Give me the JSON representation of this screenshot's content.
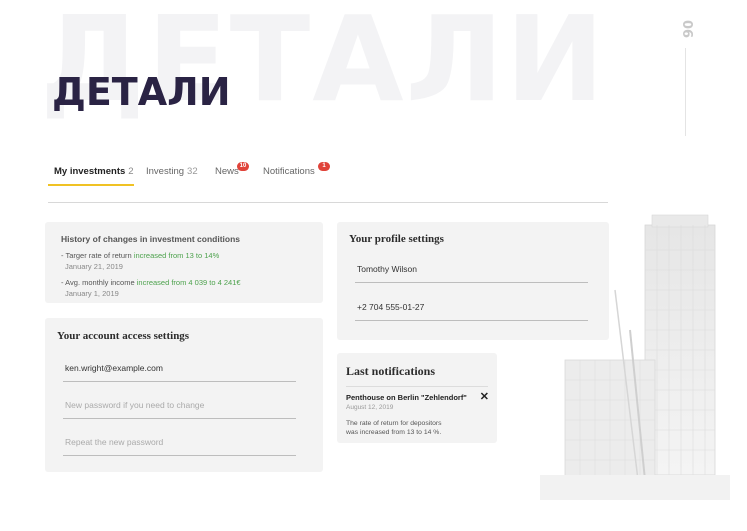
{
  "page": {
    "bg_title": "ДЕТАЛИ",
    "title": "ДЕТАЛИ",
    "page_number": "06"
  },
  "tabs": [
    {
      "label": "My investments",
      "count": "2",
      "badge": ""
    },
    {
      "label": "Investing",
      "count": "32",
      "badge": ""
    },
    {
      "label": "News",
      "count": "",
      "badge": "10"
    },
    {
      "label": "Notifications",
      "count": "",
      "badge": "1"
    }
  ],
  "history": {
    "title": "History of changes in investment conditions",
    "items": [
      {
        "prefix": "- Targer rate of return ",
        "change": "increased from 13 to 14%",
        "date": "January 21, 2019"
      },
      {
        "prefix": "- Avg. monthly income ",
        "change": "increased from 4 039 to 4 241€",
        "date": "January 1, 2019"
      }
    ]
  },
  "access": {
    "title": "Your account access settings",
    "email": "ken.wright@example.com",
    "new_password_placeholder": "New password if you need to change",
    "repeat_password_placeholder": "Repeat the new password"
  },
  "profile": {
    "title": "Your profile settings",
    "name": "Tomothy Wilson",
    "phone": "+2 704 555-01-27"
  },
  "notifications": {
    "title": "Last notifications",
    "item_title": "Penthouse on Berlin \"Zehlendorf\"",
    "item_date": "August 12, 2019",
    "item_text_1": "The rate of return for depositors",
    "item_text_2": "was increased from 13 to 14 %."
  },
  "colors": {
    "accent": "#f0c224",
    "title": "#2a2344",
    "badge": "#e0433a",
    "positive": "#4da24d",
    "card_bg": "#f3f3f3"
  }
}
